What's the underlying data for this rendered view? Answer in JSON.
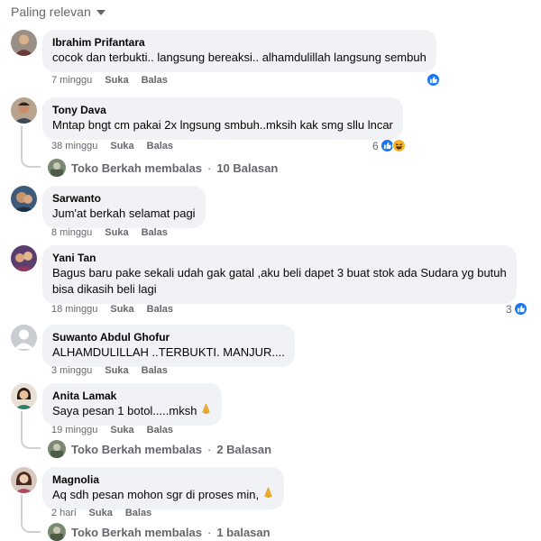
{
  "sort_label": "Paling relevan",
  "reply_author_label": "Toko Berkah membalas",
  "comments": [
    {
      "author": "Ibrahim Prifantara",
      "lines": [
        "cocok dan terbukti.. langsung bereaksi.. alhamdulillah langsung sembuh"
      ],
      "time": "7 minggu",
      "like": "Suka",
      "reply": "Balas",
      "reactions": {
        "count": "",
        "icons": [
          "like-icon"
        ]
      }
    },
    {
      "author": "Tony Dava",
      "lines": [
        "Mntap bngt cm pakai 2x lngsung smbuh..mksih kak smg sllu lncar"
      ],
      "time": "38 minggu",
      "like": "Suka",
      "reply": "Balas",
      "reactions": {
        "count": "6",
        "icons": [
          "like-icon",
          "haha-icon"
        ]
      },
      "replies": "10 Balasan"
    },
    {
      "author": "Sarwanto",
      "lines": [
        "Jum'at berkah selamat pagi"
      ],
      "time": "8 minggu",
      "like": "Suka",
      "reply": "Balas"
    },
    {
      "author": "Yani Tan",
      "lines": [
        "Bagus baru pake sekali udah gak gatal ,aku beli dapet 3 buat stok ada Sudara yg butuh",
        "bisa dikasih beli lagi"
      ],
      "time": "18 minggu",
      "like": "Suka",
      "reply": "Balas",
      "reactions": {
        "count": "3",
        "icons": [
          "like-icon"
        ]
      }
    },
    {
      "author": "Suwanto Abdul Ghofur",
      "lines": [
        "ALHAMDULILLAH ..TERBUKTI. MANJUR...."
      ],
      "time": "3 minggu",
      "like": "Suka",
      "reply": "Balas"
    },
    {
      "author": "Anita Lamak",
      "lines": [
        "Saya pesan 1 botol.....mksh"
      ],
      "time": "19 minggu",
      "like": "Suka",
      "reply": "Balas",
      "emoji": "folded-hands-icon",
      "replies": "2 Balasan"
    },
    {
      "author": "Magnolia",
      "lines": [
        "Aq sdh pesan mohon sgr di proses min,"
      ],
      "time": "2 hari",
      "like": "Suka",
      "reply": "Balas",
      "emoji": "folded-hands-icon",
      "replies": "1 balasan"
    }
  ]
}
